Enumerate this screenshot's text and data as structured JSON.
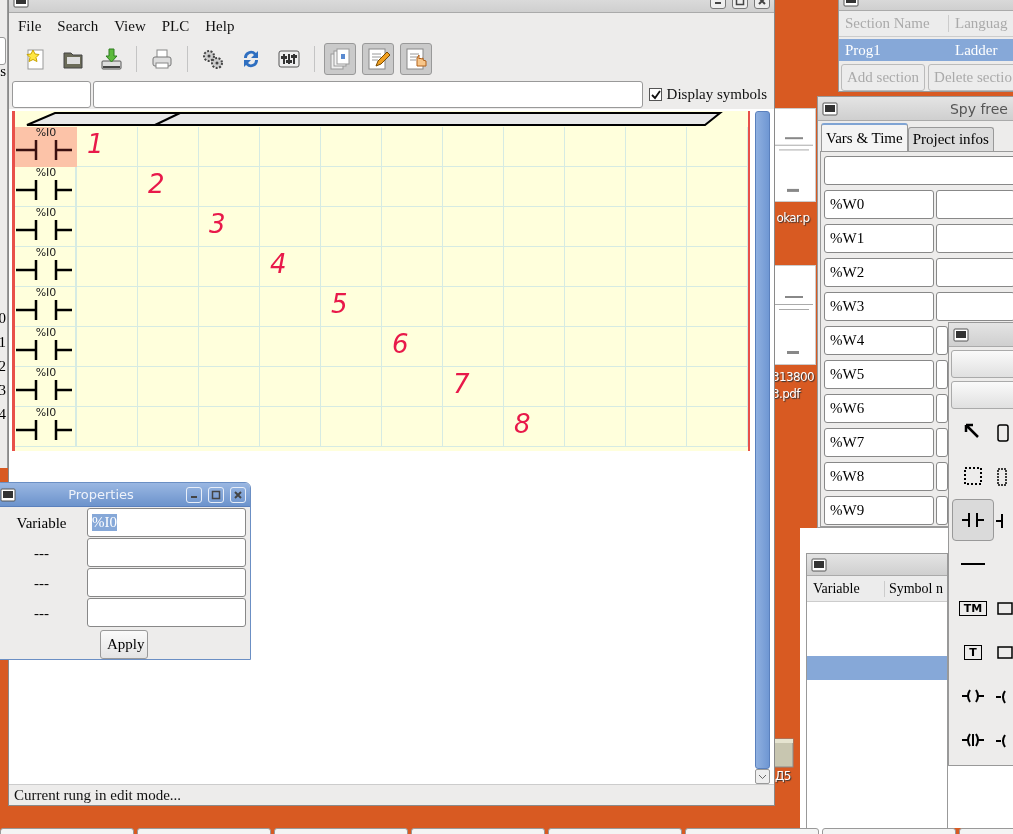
{
  "desktop": {
    "edge_texts": [
      "s",
      "0",
      "1",
      "2",
      "3",
      "4"
    ],
    "icons": [
      {
        "kind": "document",
        "label": [
          "okar.p"
        ]
      },
      {
        "kind": "document",
        "label": [
          "313800",
          "3.pdf"
        ]
      },
      {
        "kind": "folder",
        "label": [
          "Д5"
        ]
      }
    ]
  },
  "main_window": {
    "menu": [
      "File",
      "Search",
      "View",
      "PLC",
      "Help"
    ],
    "toolbar": [
      {
        "pressed": false
      },
      {
        "pressed": false
      },
      {
        "pressed": false
      },
      {
        "pressed": false
      },
      {
        "pressed": false
      },
      {
        "pressed": false
      },
      {
        "pressed": false
      },
      {
        "pressed": true
      },
      {
        "pressed": true
      },
      {
        "pressed": true
      }
    ],
    "display_symbols": {
      "label": "Display symbols",
      "checked": true
    },
    "ladder": {
      "rungs": [
        {
          "variable": "%I0",
          "selected": true
        },
        {
          "variable": "%I0",
          "selected": false
        },
        {
          "variable": "%I0",
          "selected": false
        },
        {
          "variable": "%I0",
          "selected": false
        },
        {
          "variable": "%I0",
          "selected": false
        },
        {
          "variable": "%I0",
          "selected": false
        },
        {
          "variable": "%I0",
          "selected": false
        },
        {
          "variable": "%I0",
          "selected": false
        }
      ],
      "annotations": [
        "1",
        "2",
        "3",
        "4",
        "5",
        "6",
        "7",
        "8"
      ]
    },
    "status_bar": "Current rung in edit mode..."
  },
  "properties": {
    "title": "Properties",
    "fields": [
      {
        "label": "Variable",
        "value": "%I0",
        "highlighted": true
      },
      {
        "label": "---"
      },
      {
        "label": "---"
      },
      {
        "label": "---"
      }
    ],
    "button": "Apply"
  },
  "sections": {
    "columns": [
      "Section Name",
      "Languag"
    ],
    "rows": [
      {
        "cells": [
          "Prog1",
          "Ladder"
        ],
        "selected": true
      }
    ],
    "buttons": [
      {
        "label": "Add section",
        "disabled": true
      },
      {
        "label": "Delete sectio",
        "disabled": true
      }
    ]
  },
  "spy": {
    "title": "Spy free",
    "tabs": [
      {
        "label": "Vars & Time",
        "selected": true
      },
      {
        "label": "Project infos",
        "selected": false
      }
    ],
    "vars": [
      "%W0",
      "%W1",
      "%W2",
      "%W3",
      "%W4",
      "%W5",
      "%W6",
      "%W7",
      "%W8",
      "%W9"
    ]
  },
  "symbols": {
    "columns": [
      "Variable",
      "Symbol n"
    ],
    "rows": [
      {
        "selected": false
      },
      {
        "selected": false
      },
      {
        "selected": true
      }
    ]
  },
  "toolbox": {
    "tools": [
      {
        "kind": "pointer",
        "selected": false
      },
      {
        "kind": "select",
        "selected": false
      },
      {
        "kind": "contact",
        "selected": true
      },
      {
        "kind": "line",
        "selected": false
      },
      {
        "kind": "box",
        "label": "TM",
        "selected": false
      },
      {
        "kind": "box",
        "label": "T",
        "selected": false
      },
      {
        "kind": "coil",
        "selected": false
      },
      {
        "kind": "coil_negated",
        "selected": false
      }
    ]
  }
}
